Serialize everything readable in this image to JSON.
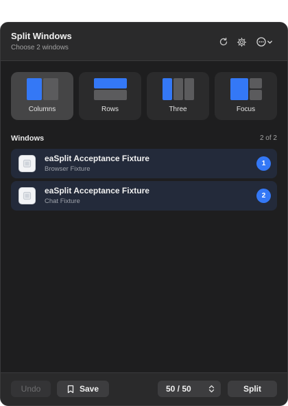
{
  "header": {
    "title": "Split Windows",
    "subtitle": "Choose 2 windows",
    "icons": [
      "refresh-icon",
      "gear-icon",
      "more-icon",
      "chevron-down-icon"
    ]
  },
  "layouts": [
    {
      "label": "Columns",
      "selected": true
    },
    {
      "label": "Rows",
      "selected": false
    },
    {
      "label": "Three",
      "selected": false
    },
    {
      "label": "Focus",
      "selected": false
    }
  ],
  "windows": {
    "title": "Windows",
    "count": "2 of 2",
    "items": [
      {
        "title": "eaSplit Acceptance Fixture",
        "subtitle": "Browser Fixture",
        "badge": "1"
      },
      {
        "title": "eaSplit Acceptance Fixture",
        "subtitle": "Chat Fixture",
        "badge": "2"
      }
    ]
  },
  "footer": {
    "undo_label": "Undo",
    "save_label": "Save",
    "ratio_label": "50 / 50",
    "split_label": "Split"
  },
  "colors": {
    "accent": "#3478f6",
    "panel_bg": "#1e1e1f",
    "row_bg": "#232a3a"
  }
}
